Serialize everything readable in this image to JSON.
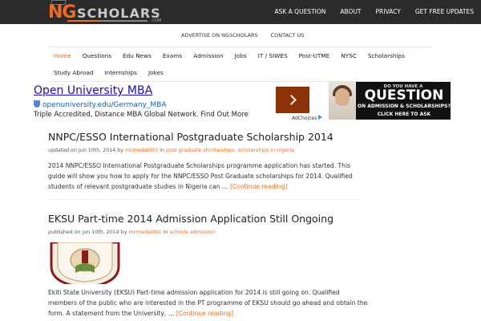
{
  "site": {
    "logo_ng": "NG",
    "logo_scholars": "SCHOLARS",
    "logo_com": ".COM"
  },
  "top_nav": [
    "ASK A QUESTION",
    "ABOUT",
    "PRIVACY",
    "GET FREE UPDATES"
  ],
  "secondary_nav": [
    "ADVERTISE ON NGSCHOLARS",
    "CONTACT US"
  ],
  "main_nav": {
    "items": [
      "Home",
      "Questions",
      "Edu News",
      "Exams",
      "Admission",
      "Jobs",
      "IT / SIWES",
      "Post-UTME",
      "NYSC",
      "Scholarships",
      "Study Abroad",
      "Internships",
      "Jokes"
    ],
    "active": "Home"
  },
  "ad": {
    "title": "Open University MBA",
    "url": "openuniversity.edu/Germany_MBA",
    "description": "Triple Accredited, Distance MBA Global Network. Find Out More",
    "adchoices": "AdChoices"
  },
  "banner": {
    "line1": "DO YOU HAVE A",
    "line2": "QUESTION",
    "line3": "ON ADMISSION & SCHOLARSHIPS?",
    "line4": "CLICK HERE TO ASK"
  },
  "posts": [
    {
      "title": "NNPC/ESSO International Postgraduate Scholarship 2014",
      "meta_prefix": "updated on jun 10th, 2014 by",
      "author": "mcmedal001",
      "meta_in": "in",
      "categories": "post graduate shcolarships, scholarships in nigeria",
      "excerpt": "2014 NNPC/ESSO International Postgraduate Scholarships programme application has started. This guide will show you how to apply for the NNPC/ESSO Post Graduate scholarships for 2014. Qualified students of relevant postgraduate studies in Nigeria can …",
      "more": "[Continue reading]"
    },
    {
      "title": "EKSU Part-time 2014 Admission Application Still Ongoing",
      "meta_prefix": "published on jun 10th, 2014 by",
      "author": "mcmedal001",
      "meta_in": "in",
      "categories": "schools admission",
      "excerpt": "Ekiti State University (EKSU) Part-time admission application for 2014 is still going on. Qualified members of the public who are interested in the PT programme of EKSU should go ahead and obtain the form. A statement from the University, …",
      "more": "[Continue reading]"
    }
  ],
  "colors": {
    "accent": "#f26b1d",
    "topbar": "#2b2b2b",
    "ad_link": "#1a0dab"
  }
}
